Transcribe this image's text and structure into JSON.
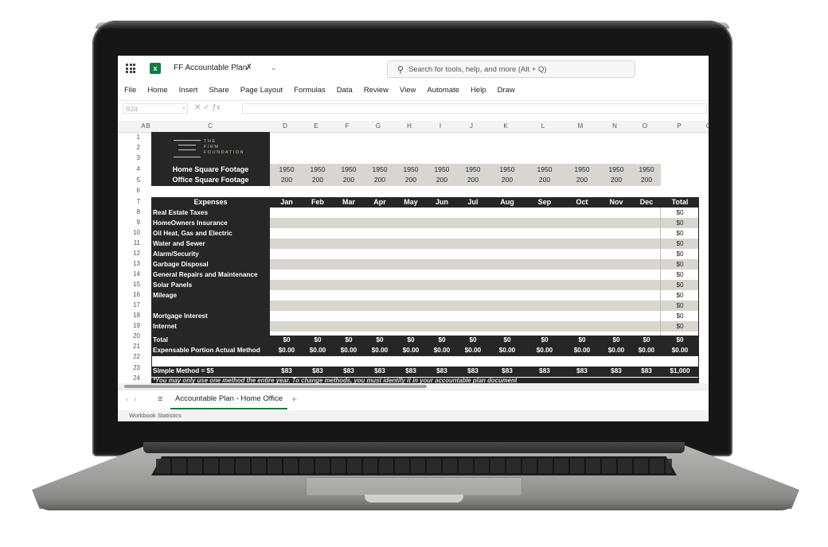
{
  "app": {
    "doc_title": "FF Accountable Plan",
    "search_placeholder": "Search for tools, help, and more (Alt + Q)",
    "xl_letter": "x"
  },
  "menu": [
    "File",
    "Home",
    "Insert",
    "Share",
    "Page Layout",
    "Formulas",
    "Data",
    "Review",
    "View",
    "Automate",
    "Help",
    "Draw"
  ],
  "formula_bar": {
    "name_box": "R24"
  },
  "columns": [
    "A",
    "B",
    "C",
    "D",
    "E",
    "F",
    "G",
    "H",
    "I",
    "J",
    "K",
    "L",
    "M",
    "N",
    "O",
    "P",
    "Q"
  ],
  "rows": [
    "1",
    "2",
    "3",
    "4",
    "5",
    "6",
    "7",
    "8",
    "9",
    "10",
    "11",
    "12",
    "13",
    "14",
    "15",
    "16",
    "17",
    "18",
    "19",
    "20",
    "21",
    "22",
    "23",
    "24"
  ],
  "logo": {
    "line1": "THE",
    "line2": "FIRM",
    "line3": "FOUNDATION"
  },
  "sqft": {
    "home_label": "Home Square Footage",
    "office_label": "Office Square Footage",
    "home": [
      "1950",
      "1950",
      "1950",
      "1950",
      "1950",
      "1950",
      "1950",
      "1950",
      "1950",
      "1950",
      "1950",
      "1950"
    ],
    "office": [
      "200",
      "200",
      "200",
      "200",
      "200",
      "200",
      "200",
      "200",
      "200",
      "200",
      "200",
      "200"
    ]
  },
  "expenses_header": {
    "label": "Expenses",
    "months": [
      "Jan",
      "Feb",
      "Mar",
      "Apr",
      "May",
      "Jun",
      "Jul",
      "Aug",
      "Sep",
      "Oct",
      "Nov",
      "Dec"
    ],
    "total": "Total"
  },
  "expense_items": [
    "Real Estate Taxes",
    "HomeOwners Insurance",
    "Oil Heat, Gas and Electric",
    "Water and Sewer",
    "Alarm/Security",
    "Garbage Disposal",
    "General Repairs and Maintenance",
    "Solar Panels",
    "Mileage",
    "",
    "Mortgage Interest",
    "Internet"
  ],
  "expense_totals": [
    "$0",
    "$0",
    "$0",
    "$0",
    "$0",
    "$0",
    "$0",
    "$0",
    "$0",
    "$0",
    "$0",
    "$0"
  ],
  "total_row": {
    "label": "Total",
    "values": [
      "$0",
      "$0",
      "$0",
      "$0",
      "$0",
      "$0",
      "$0",
      "$0",
      "$0",
      "$0",
      "$0",
      "$0"
    ],
    "total": "$0"
  },
  "expensable_row": {
    "label": "Expensable Portion Actual Method",
    "values": [
      "$0.00",
      "$0.00",
      "$0.00",
      "$0.00",
      "$0.00",
      "$0.00",
      "$0.00",
      "$0.00",
      "$0.00",
      "$0.00",
      "$0.00",
      "$0.00"
    ],
    "total": "$0.00"
  },
  "simple_row": {
    "label": "Simple Method = $5",
    "values": [
      "$83",
      "$83",
      "$83",
      "$83",
      "$83",
      "$83",
      "$83",
      "$83",
      "$83",
      "$83",
      "$83",
      "$83"
    ],
    "total": "$1,000"
  },
  "note": "*You may only use one method the entire year. To change methods, you must identify it in your accountable plan document",
  "sheet_tab": "Accountable Plan - Home Office",
  "status": "Workbook Statistics"
}
